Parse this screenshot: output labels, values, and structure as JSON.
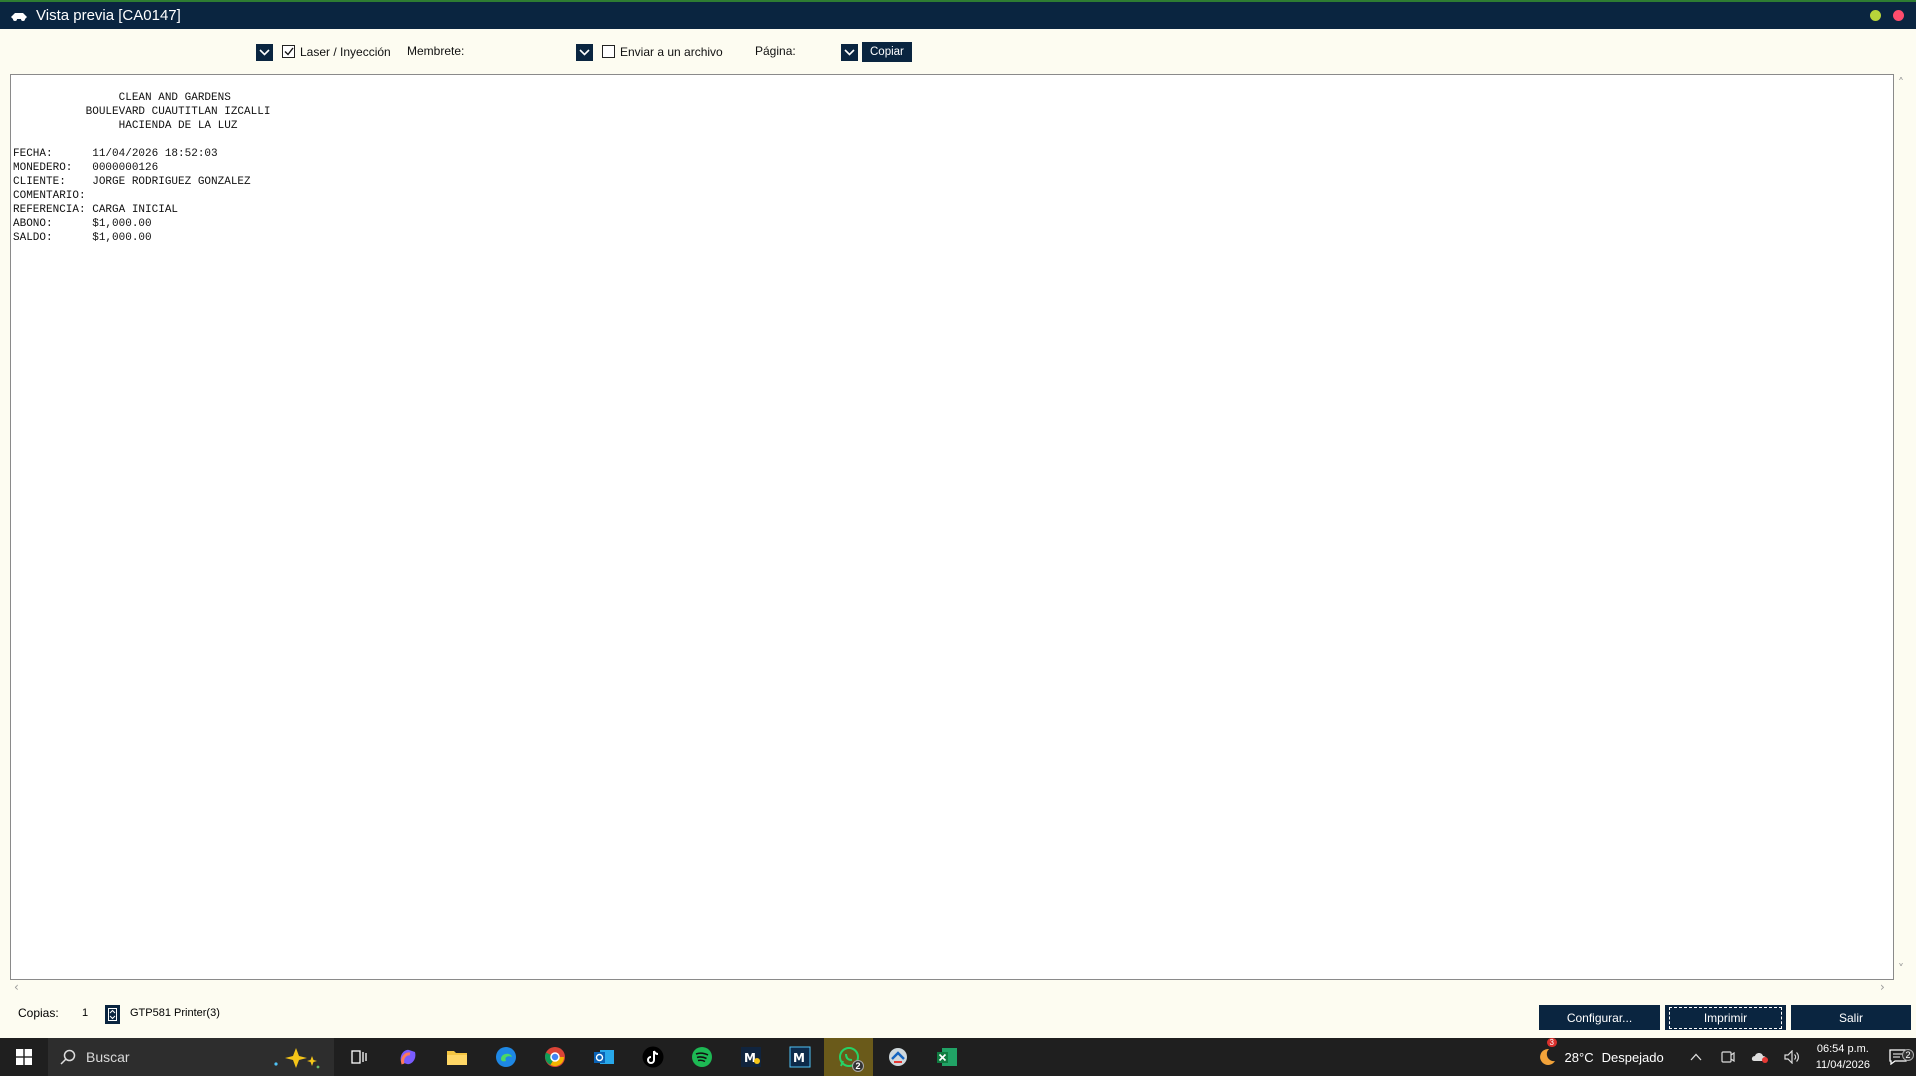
{
  "window": {
    "title": "Vista previa [CA0147]"
  },
  "toolbar": {
    "printer_type_value": "",
    "laser_label": "Laser / Inyección",
    "laser_checked": true,
    "membrete_label": "Membrete:",
    "membrete_value": "",
    "send_to_file_label": "Enviar a un archivo",
    "send_to_file_checked": false,
    "page_label": "Página:",
    "page_value": "",
    "copy_button": "Copiar"
  },
  "document": {
    "lines": [
      "                CLEAN AND GARDENS",
      "           BOULEVARD CUAUTITLAN IZCALLI",
      "                HACIENDA DE LA LUZ",
      "",
      "FECHA:      11/04/2026 18:52:03",
      "MONEDERO:   0000000126",
      "CLIENTE:    JORGE RODRIGUEZ GONZALEZ",
      "COMENTARIO:",
      "REFERENCIA: CARGA INICIAL",
      "ABONO:      $1,000.00",
      "SALDO:      $1,000.00"
    ]
  },
  "bottom": {
    "copies_label": "Copias:",
    "copies_value": "1",
    "printer_name": "GTP581 Printer(3)",
    "configure_button": "Configurar...",
    "print_button": "Imprimir",
    "exit_button": "Salir"
  },
  "taskbar": {
    "search_placeholder": "Buscar",
    "whatsapp_badge": "2",
    "weather_badge": "3",
    "weather_temp": "28°C",
    "weather_text": "Despejado",
    "time": "06:54 p.m.",
    "date": "11/04/2026",
    "notifications_badge": "2"
  },
  "colors": {
    "titlebar": "#0a2540",
    "background": "#fdfcf1",
    "button": "#0a2540"
  }
}
